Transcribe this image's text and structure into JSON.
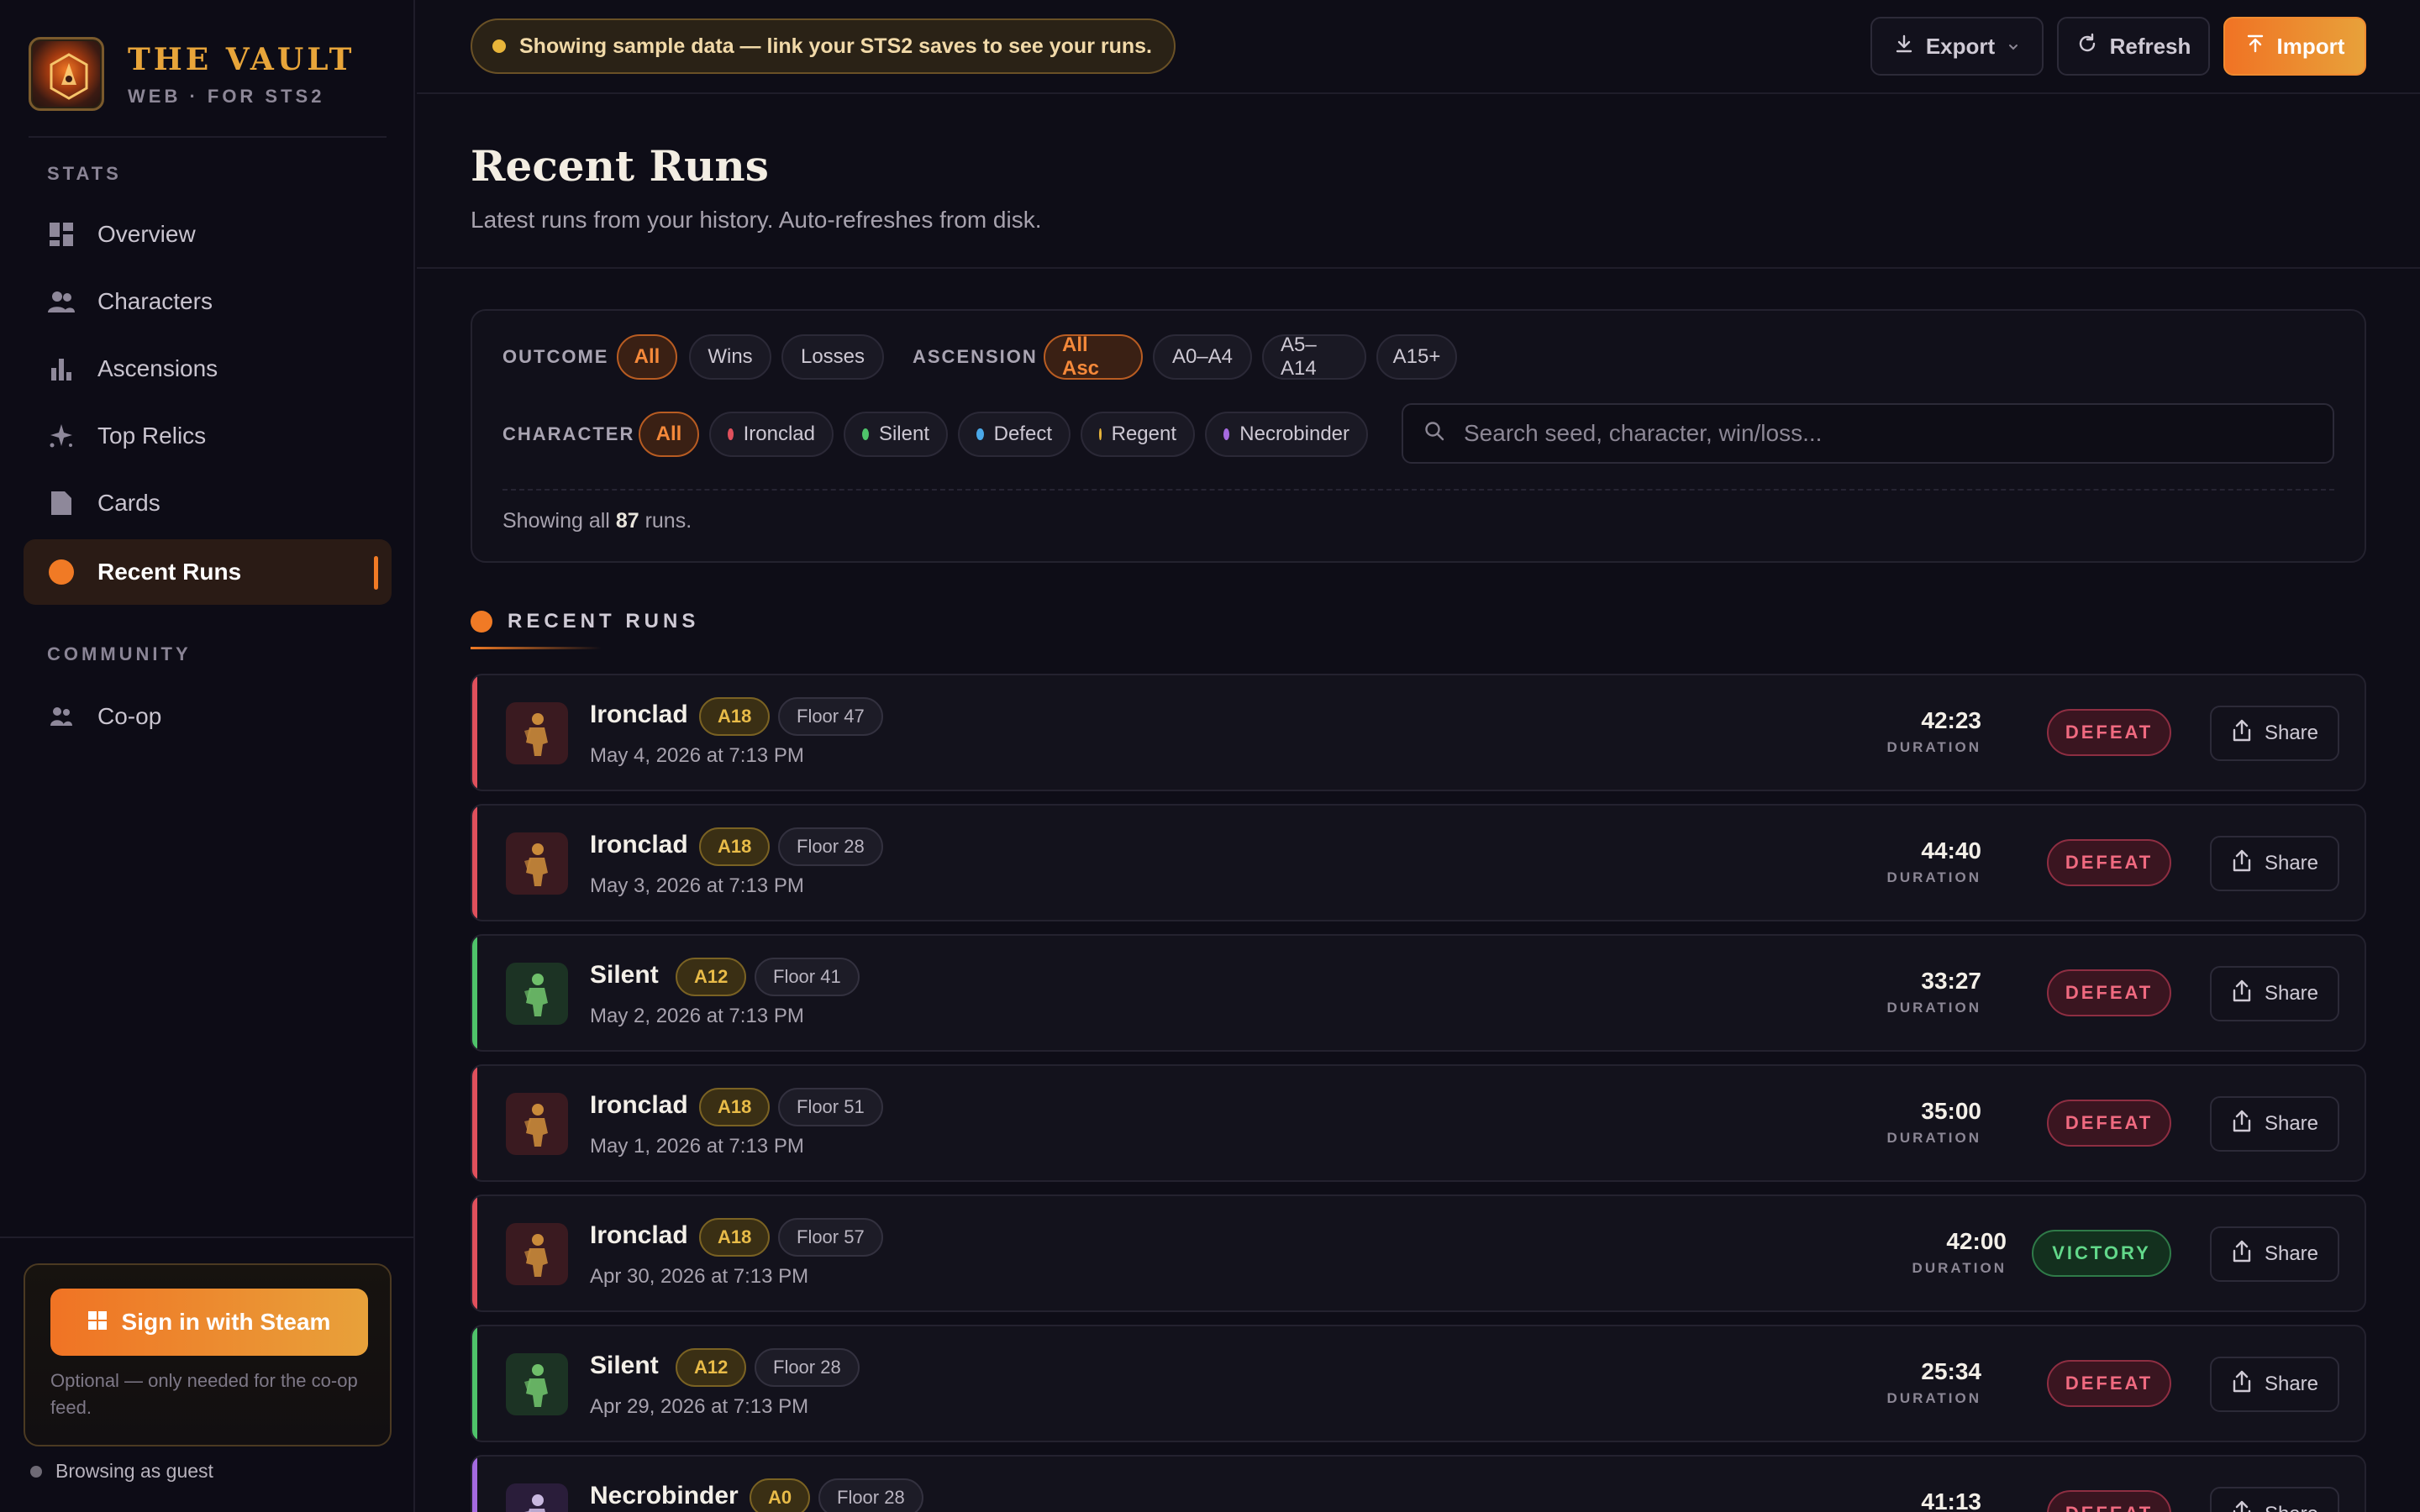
{
  "brand": {
    "title": "THE VAULT",
    "subtitle": "WEB · FOR STS2"
  },
  "sidebar": {
    "sections": [
      {
        "label": "STATS"
      },
      {
        "label": "COMMUNITY"
      }
    ],
    "items": [
      {
        "label": "Overview",
        "icon": "grid-icon"
      },
      {
        "label": "Characters",
        "icon": "users-icon"
      },
      {
        "label": "Ascensions",
        "icon": "bar-chart-icon"
      },
      {
        "label": "Top Relics",
        "icon": "sparkle-icon"
      },
      {
        "label": "Cards",
        "icon": "card-icon"
      },
      {
        "label": "Recent Runs",
        "icon": "dot-icon",
        "active": true
      },
      {
        "label": "Co-op",
        "icon": "people-icon"
      }
    ],
    "signin": {
      "button_label": "Sign in with Steam",
      "note": "Optional — only needed for the co-op feed."
    },
    "guest_label": "Browsing as guest"
  },
  "topbar": {
    "notice": "Showing sample data — link your STS2 saves to see your runs.",
    "export_label": "Export",
    "refresh_label": "Refresh",
    "import_label": "Import"
  },
  "header": {
    "title": "Recent Runs",
    "subtitle": "Latest runs from your history. Auto-refreshes from disk."
  },
  "filters": {
    "outcome_label": "OUTCOME",
    "outcome_options": [
      "All",
      "Wins",
      "Losses"
    ],
    "ascension_label": "ASCENSION",
    "ascension_options": [
      "All Asc",
      "A0–A4",
      "A5–A14",
      "A15+"
    ],
    "character_label": "CHARACTER",
    "character_options": [
      {
        "label": "All"
      },
      {
        "label": "Ironclad",
        "color": "#e0505c"
      },
      {
        "label": "Silent",
        "color": "#4fc36a"
      },
      {
        "label": "Defect",
        "color": "#4aa8e8"
      },
      {
        "label": "Regent",
        "color": "#e8b53a"
      },
      {
        "label": "Necrobinder",
        "color": "#a56ae0"
      }
    ],
    "search_placeholder": "Search seed, character, win/loss...",
    "showing_prefix": "Showing all",
    "showing_count": "87",
    "showing_suffix": "runs."
  },
  "runs_section": {
    "title": "RECENT RUNS"
  },
  "colors": {
    "accent": "#f07a25",
    "ironclad": "#e0505c",
    "silent": "#4fc36a",
    "necrobinder": "#a56ae0",
    "defeat": "#f06a80",
    "victory": "#62d88a"
  },
  "runs": [
    {
      "character": "Ironclad",
      "ascension": "A18",
      "floor": "Floor 47",
      "date": "May 4, 2026 at 7:13 PM",
      "duration": "42:23",
      "duration_label": "DURATION",
      "result": "DEFEAT",
      "share": "Share"
    },
    {
      "character": "Ironclad",
      "ascension": "A18",
      "floor": "Floor 28",
      "date": "May 3, 2026 at 7:13 PM",
      "duration": "44:40",
      "duration_label": "DURATION",
      "result": "DEFEAT",
      "share": "Share"
    },
    {
      "character": "Silent",
      "ascension": "A12",
      "floor": "Floor 41",
      "date": "May 2, 2026 at 7:13 PM",
      "duration": "33:27",
      "duration_label": "DURATION",
      "result": "DEFEAT",
      "share": "Share"
    },
    {
      "character": "Ironclad",
      "ascension": "A18",
      "floor": "Floor 51",
      "date": "May 1, 2026 at 7:13 PM",
      "duration": "35:00",
      "duration_label": "DURATION",
      "result": "DEFEAT",
      "share": "Share"
    },
    {
      "character": "Ironclad",
      "ascension": "A18",
      "floor": "Floor 57",
      "date": "Apr 30, 2026 at 7:13 PM",
      "duration": "42:00",
      "duration_label": "DURATION",
      "result": "VICTORY",
      "share": "Share"
    },
    {
      "character": "Silent",
      "ascension": "A12",
      "floor": "Floor 28",
      "date": "Apr 29, 2026 at 7:13 PM",
      "duration": "25:34",
      "duration_label": "DURATION",
      "result": "DEFEAT",
      "share": "Share"
    },
    {
      "character": "Necrobinder",
      "ascension": "A0",
      "floor": "Floor 28",
      "date": "",
      "duration": "41:13",
      "duration_label": "DURATION",
      "result": "DEFEAT",
      "share": "Share"
    }
  ]
}
